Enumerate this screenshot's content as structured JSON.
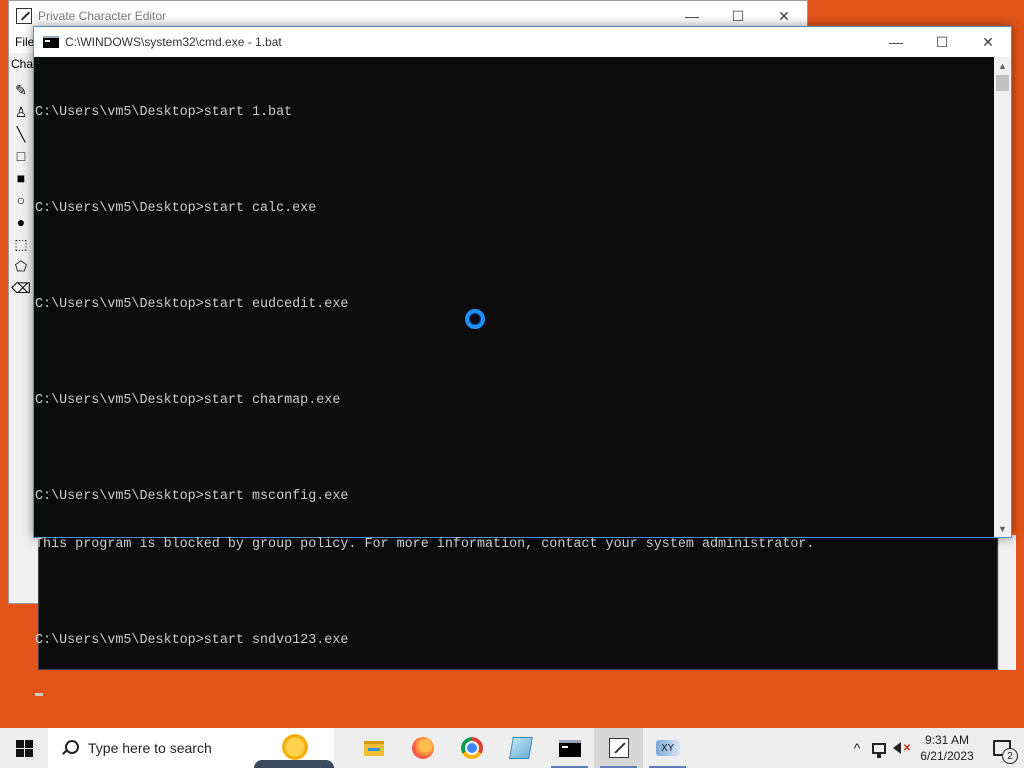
{
  "pce_window": {
    "title": "Private Character Editor",
    "menu_visible": "File",
    "toolbar_label": "Char",
    "controls": {
      "minimize": "—",
      "maximize": "☐",
      "close": "✕"
    },
    "tools": [
      "✎",
      "♙",
      "╲",
      "□",
      "■",
      "○",
      "●",
      "⬚",
      "⬠",
      "⌫"
    ]
  },
  "cmd_window": {
    "title": "C:\\WINDOWS\\system32\\cmd.exe - 1.bat",
    "controls": {
      "minimize": "—",
      "maximize": "☐",
      "close": "✕"
    },
    "lines": [
      "C:\\Users\\vm5\\Desktop>start 1.bat",
      "",
      "C:\\Users\\vm5\\Desktop>start calc.exe",
      "",
      "C:\\Users\\vm5\\Desktop>start eudcedit.exe",
      "",
      "C:\\Users\\vm5\\Desktop>start charmap.exe",
      "",
      "C:\\Users\\vm5\\Desktop>start msconfig.exe",
      "This program is blocked by group policy. For more information, contact your system administrator.",
      "",
      "C:\\Users\\vm5\\Desktop>start sndvo123.exe"
    ],
    "scroll_up": "▲",
    "scroll_down": "▼"
  },
  "taskbar": {
    "search_placeholder": "Type here to search",
    "apps": [
      "file-explorer",
      "firefox",
      "chrome",
      "notepad",
      "command-prompt",
      "private-character-editor",
      "character-map"
    ],
    "active_app": "private-character-editor",
    "tray": {
      "chevron": "^",
      "time": "9:31 AM",
      "date": "6/21/2023",
      "volume_muted_mark": "✕",
      "notification_count": "2"
    }
  }
}
